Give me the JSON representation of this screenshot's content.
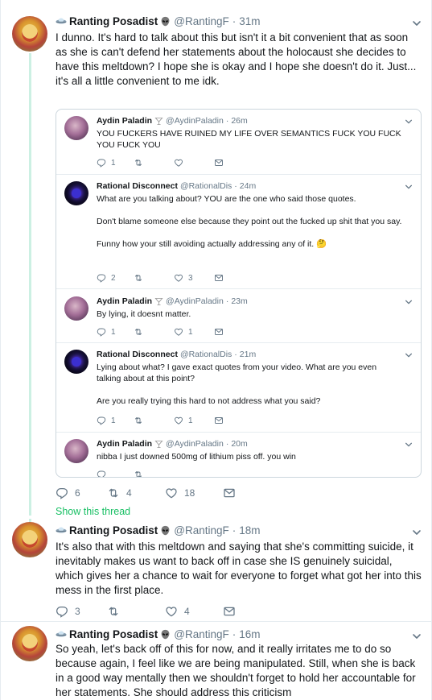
{
  "main_tweet": {
    "name": "Ranting Posadist",
    "handle": "@RantingF",
    "separator": "·",
    "time": "31m",
    "text": "I dunno. It's hard to talk about this but isn't it a bit convenient that as soon as she is can't defend her statements about the holocaust she decides to have this meltdown? I hope she is okay and I hope she doesn't do it. Just... it's all a little convenient to me idk.",
    "replies": "6",
    "retweets": "4",
    "likes": "18"
  },
  "embedded": [
    {
      "name": "Aydin Paladin",
      "handle": "@AydinPaladin",
      "separator": "·",
      "time": "26m",
      "text": [
        "YOU FUCKERS HAVE RUINED MY LIFE OVER SEMANTICS FUCK YOU FUCK YOU FUCK YOU"
      ],
      "replies": "1",
      "retweets": "",
      "likes": ""
    },
    {
      "name": "Rational Disconnect",
      "handle": "@RationalDis",
      "separator": "·",
      "time": "24m",
      "text": [
        "What are you talking about? YOU are the one who said those quotes.",
        "Don't blame someone else because they point out the fucked up shit that you say.",
        "Funny how your still avoiding actually addressing any of it. 🤔"
      ],
      "replies": "2",
      "retweets": "",
      "likes": "3"
    },
    {
      "name": "Aydin Paladin",
      "handle": "@AydinPaladin",
      "separator": "·",
      "time": "23m",
      "text": [
        "By lying, it doesnt matter."
      ],
      "replies": "1",
      "retweets": "",
      "likes": "1"
    },
    {
      "name": "Rational Disconnect",
      "handle": "@RationalDis",
      "separator": "·",
      "time": "21m",
      "text": [
        "Lying about what? I gave exact quotes from your video. What are you even talking about at this point?",
        "Are you really trying this hard to not address what you said?"
      ],
      "replies": "1",
      "retweets": "",
      "likes": "1"
    },
    {
      "name": "Aydin Paladin",
      "handle": "@AydinPaladin",
      "separator": "·",
      "time": "20m",
      "text": [
        "nibba I just downed 500mg of lithium piss off. you win"
      ],
      "replies": "",
      "retweets": "",
      "likes": ""
    }
  ],
  "show_thread": "Show this thread",
  "reply_1": {
    "name": "Ranting Posadist",
    "handle": "@RantingF",
    "separator": "·",
    "time": "18m",
    "text": "It's also that with this meltdown and saying that she's committing suicide, it inevitably makes us want to back off in case she IS genuinely suicidal, which gives her a chance to wait for everyone to forget what got her into this mess in the first place.",
    "replies": "3",
    "retweets": "",
    "likes": "4"
  },
  "reply_2": {
    "name": "Ranting Posadist",
    "handle": "@RantingF",
    "separator": "·",
    "time": "16m",
    "text": "So yeah, let's back off of this for now, and it really irritates me to do so because again, I feel like we are being manipulated. Still, when she is back in a good way mentally then we shouldn't forget to hold her accountable for her statements. She should address this criticism"
  },
  "colors": {
    "text": "#14171a",
    "muted": "#657786",
    "thread_line": "#ccf0e3",
    "show_thread": "#17bf63",
    "border": "#ccd6dd"
  },
  "icons": [
    "reply-icon",
    "retweet-icon",
    "like-icon",
    "message-icon",
    "chevron-down-icon",
    "alien-icon",
    "ufo-icon",
    "cocktail-icon",
    "thinking-face-emoji"
  ]
}
